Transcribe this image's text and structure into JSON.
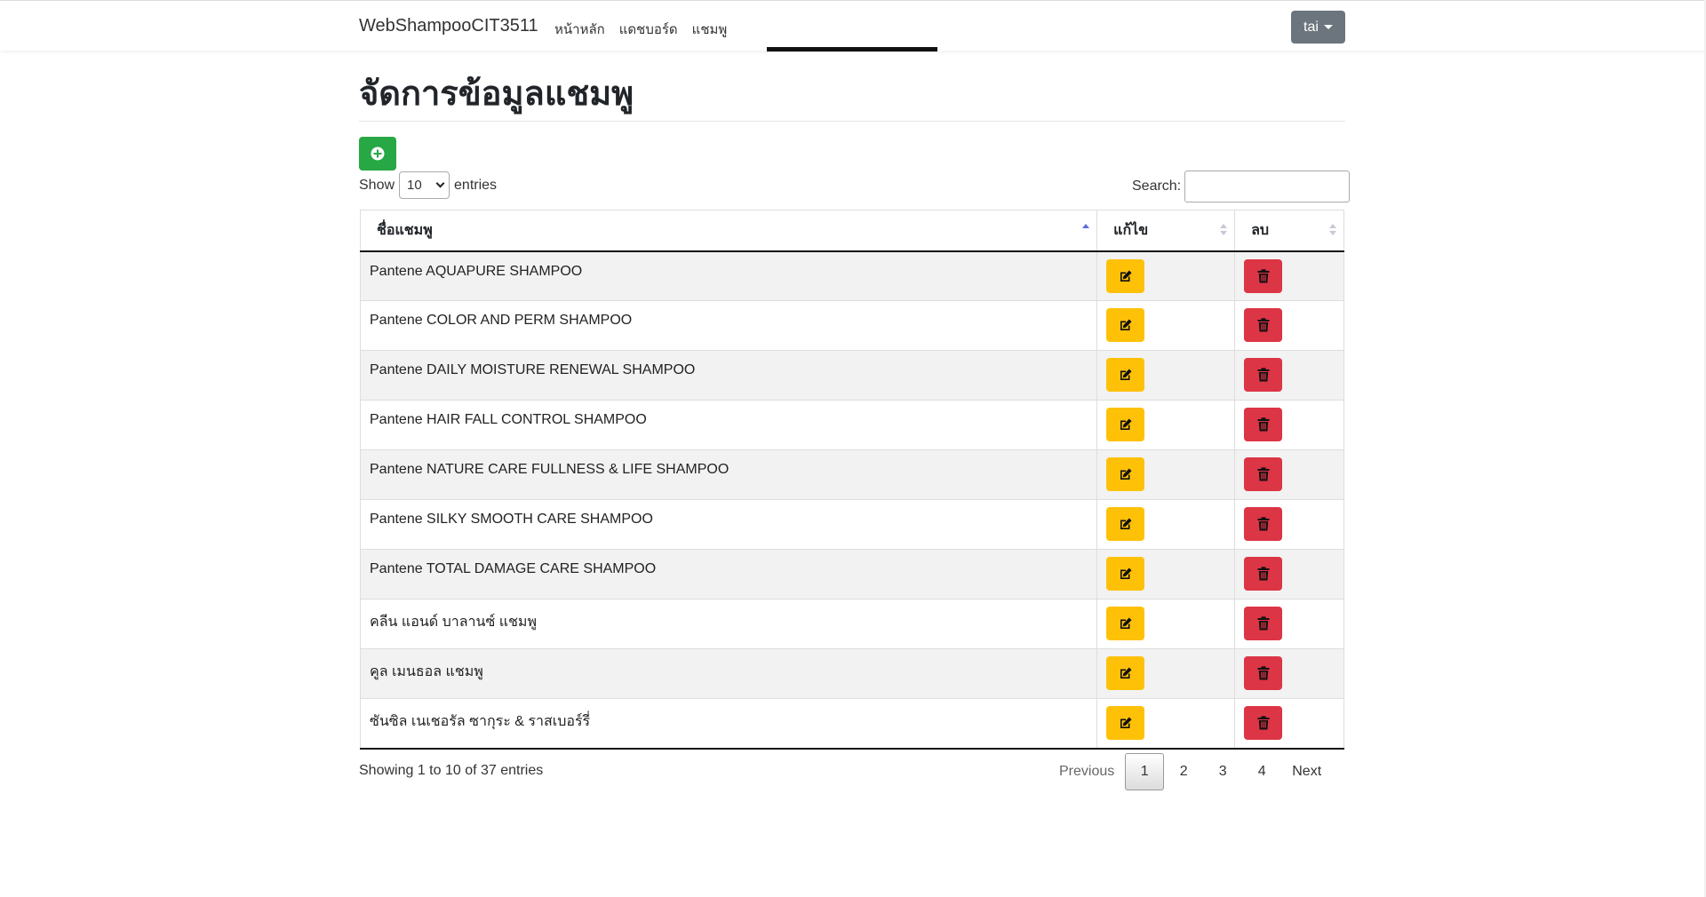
{
  "navbar": {
    "brand": "WebShampooCIT3511",
    "links": [
      "หน้าหลัก",
      "แดชบอร์ด",
      "แชมพู"
    ],
    "user": "tai"
  },
  "page": {
    "title": "จัดการข้อมูลแชมพู"
  },
  "datatable": {
    "show_label": "Show",
    "entries_label": "entries",
    "page_length": "10",
    "search_label": "Search:",
    "search_value": "",
    "columns": [
      "ชื่อแชมพู",
      "แก้ไข",
      "ลบ"
    ],
    "rows": [
      "Pantene AQUAPURE SHAMPOO",
      "Pantene COLOR AND PERM SHAMPOO",
      "Pantene DAILY MOISTURE RENEWAL SHAMPOO",
      "Pantene HAIR FALL CONTROL SHAMPOO",
      "Pantene NATURE CARE FULLNESS & LIFE SHAMPOO",
      "Pantene SILKY SMOOTH CARE SHAMPOO",
      "Pantene TOTAL DAMAGE CARE SHAMPOO",
      "คลีน แอนด์ บาลานซ์ แชมพู",
      "คูล เมนธอล แชมพู",
      "ซันซิล เนเชอรัล ซากุระ & ราสเบอร์รี่"
    ],
    "info": "Showing 1 to 10 of 37 entries",
    "pagination": {
      "previous": "Previous",
      "pages": [
        "1",
        "2",
        "3",
        "4"
      ],
      "current": "1",
      "next": "Next"
    }
  },
  "icons": {
    "add": "plus-circle-icon",
    "edit": "edit-icon",
    "delete": "trash-icon"
  },
  "colors": {
    "add_button": "#28a745",
    "edit_button": "#ffc107",
    "delete_button": "#dc3545",
    "user_button": "#6c757d"
  }
}
